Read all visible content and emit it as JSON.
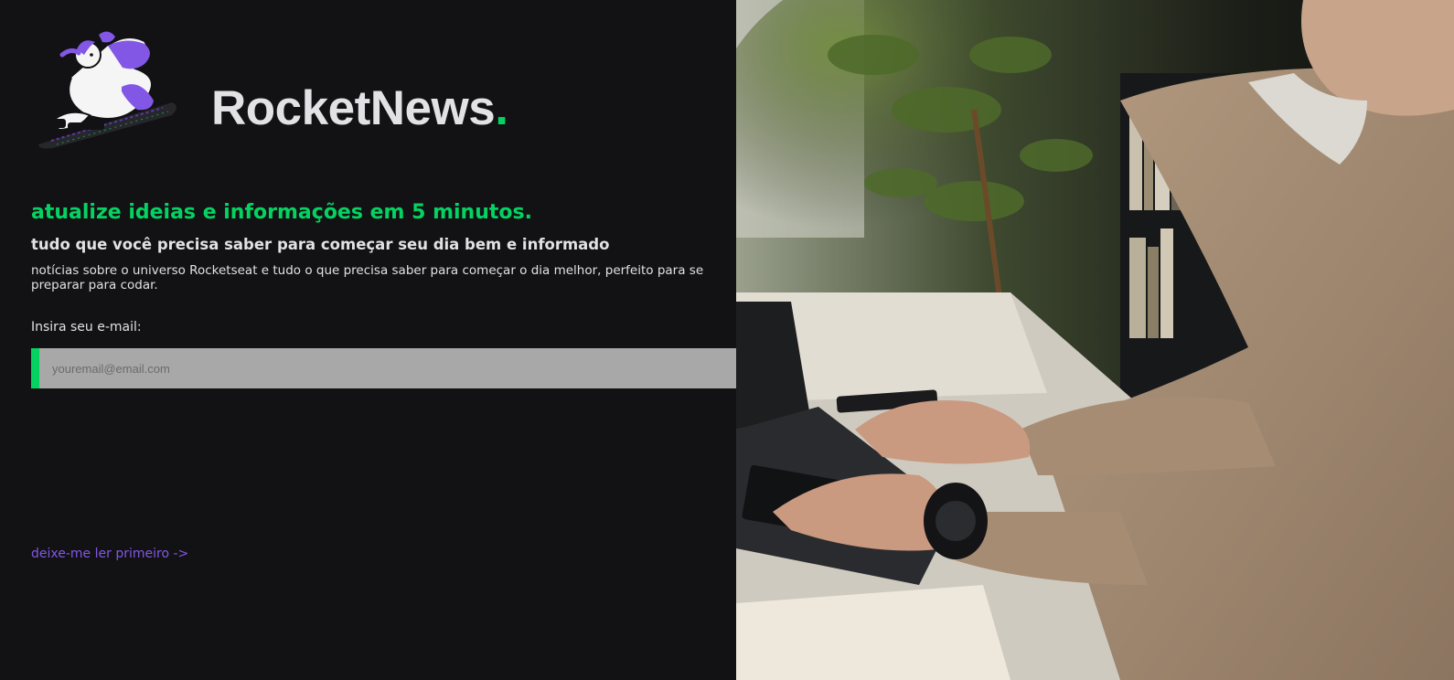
{
  "brand": {
    "name": "RocketNews",
    "dot": ".",
    "dot_color": "#04d361",
    "logo_icon": "astronaut-on-rocket-illustration"
  },
  "hero": {
    "headline": "atualize ideias e informações em 5 minutos.",
    "subheadline": "tudo que você precisa saber para começar seu dia bem e informado",
    "description": "notícias sobre o universo Rocketseat e tudo o que precisa saber para começar o dia melhor, perfeito para se preparar para codar."
  },
  "form": {
    "label": "Insira seu e-mail:",
    "placeholder": "youremail@email.com",
    "value": "",
    "submit_icon": "paper-plane-icon"
  },
  "link": {
    "read_first": "deixe-me ler primeiro ->"
  },
  "photo": {
    "subject": "man-typing-on-laptop-photo"
  },
  "colors": {
    "background": "#121214",
    "accent_green": "#04d361",
    "accent_purple": "#8257e5",
    "text": "#e1e1e6",
    "input_bg": "#a8a8a8"
  }
}
